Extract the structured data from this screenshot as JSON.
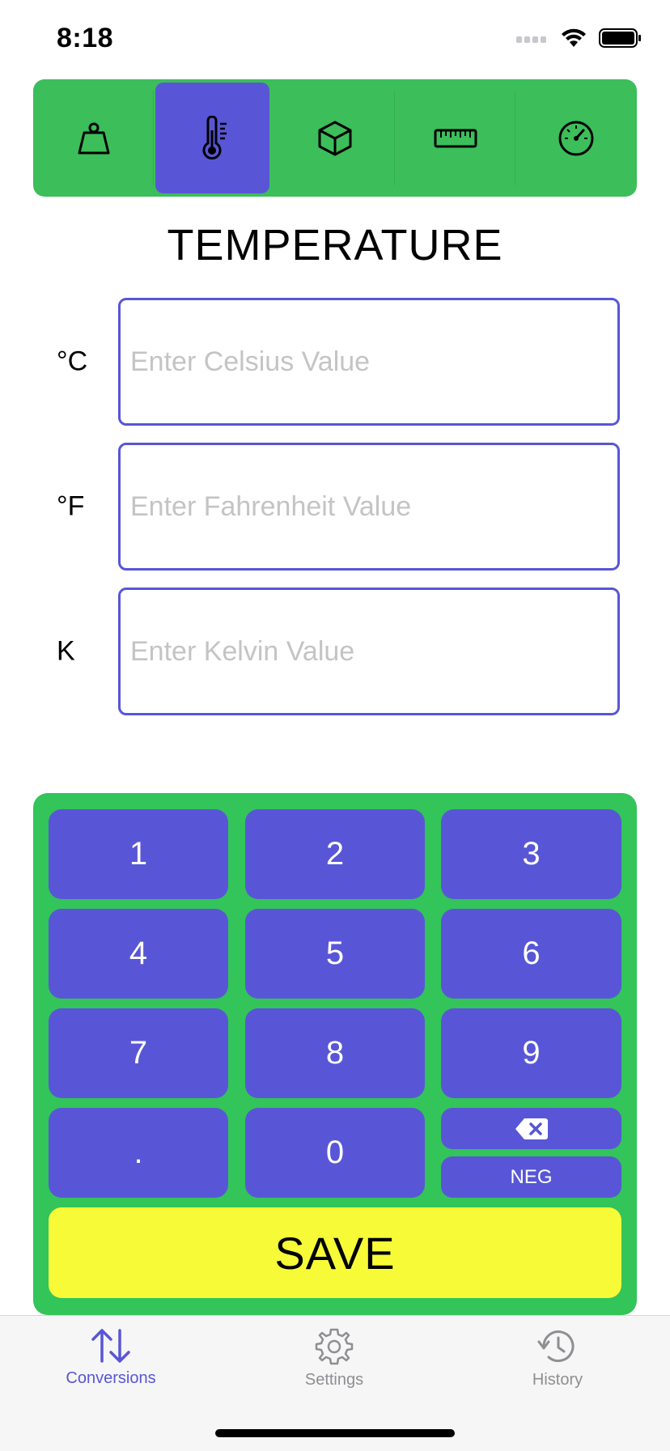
{
  "status": {
    "time": "8:18"
  },
  "categories": [
    {
      "icon": "weight-icon",
      "active": false
    },
    {
      "icon": "thermometer-icon",
      "active": true
    },
    {
      "icon": "cube-icon",
      "active": false
    },
    {
      "icon": "ruler-icon",
      "active": false
    },
    {
      "icon": "speedometer-icon",
      "active": false
    }
  ],
  "page": {
    "title": "TEMPERATURE"
  },
  "fields": [
    {
      "unit": "°C",
      "placeholder": "Enter Celsius Value",
      "value": ""
    },
    {
      "unit": "°F",
      "placeholder": "Enter Fahrenheit Value",
      "value": ""
    },
    {
      "unit": "K",
      "placeholder": "Enter Kelvin Value",
      "value": ""
    }
  ],
  "keypad": {
    "keys": [
      "1",
      "2",
      "3",
      "4",
      "5",
      "6",
      "7",
      "8",
      "9",
      ".",
      "0"
    ],
    "neg_label": "NEG",
    "backspace_icon": "backspace-icon",
    "save_label": "SAVE"
  },
  "tabs": [
    {
      "label": "Conversions",
      "icon": "arrows-up-down-icon",
      "active": true
    },
    {
      "label": "Settings",
      "icon": "gear-icon",
      "active": false
    },
    {
      "label": "History",
      "icon": "history-icon",
      "active": false
    }
  ],
  "colors": {
    "accent": "#5856d6",
    "green": "#33c45a",
    "save": "#f7fb37",
    "tab_inactive": "#8e8e93"
  }
}
